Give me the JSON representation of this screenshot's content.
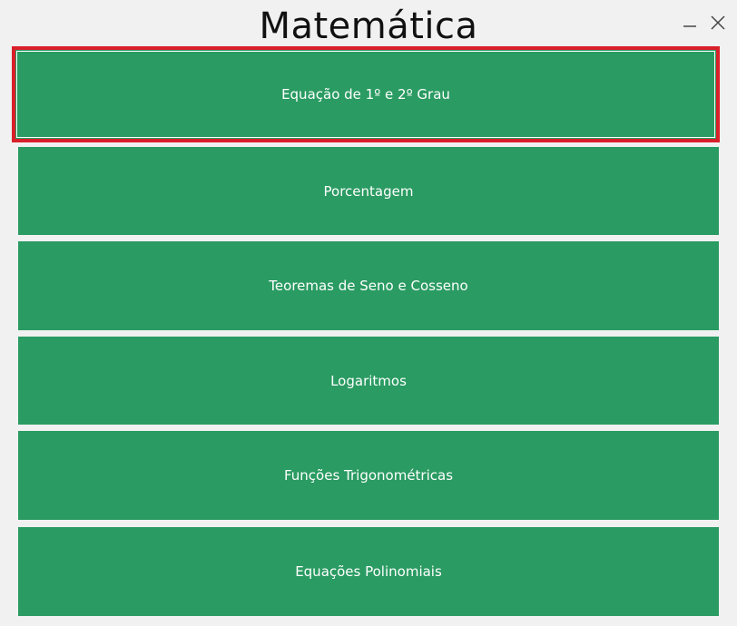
{
  "window": {
    "title": "Matemática",
    "minimize_icon": "minimize-icon",
    "close_icon": "close-icon"
  },
  "menu": {
    "items": [
      {
        "label": "Equação de 1º e 2º Grau",
        "selected": true
      },
      {
        "label": "Porcentagem"
      },
      {
        "label": "Teoremas de Seno e Cosseno"
      },
      {
        "label": "Logaritmos"
      },
      {
        "label": "Funções Trigonométricas"
      },
      {
        "label": "Equações Polinomiais"
      }
    ]
  },
  "colors": {
    "button": "#2a9b62",
    "selection_border": "#d9202a",
    "background": "#f1f1f1"
  }
}
